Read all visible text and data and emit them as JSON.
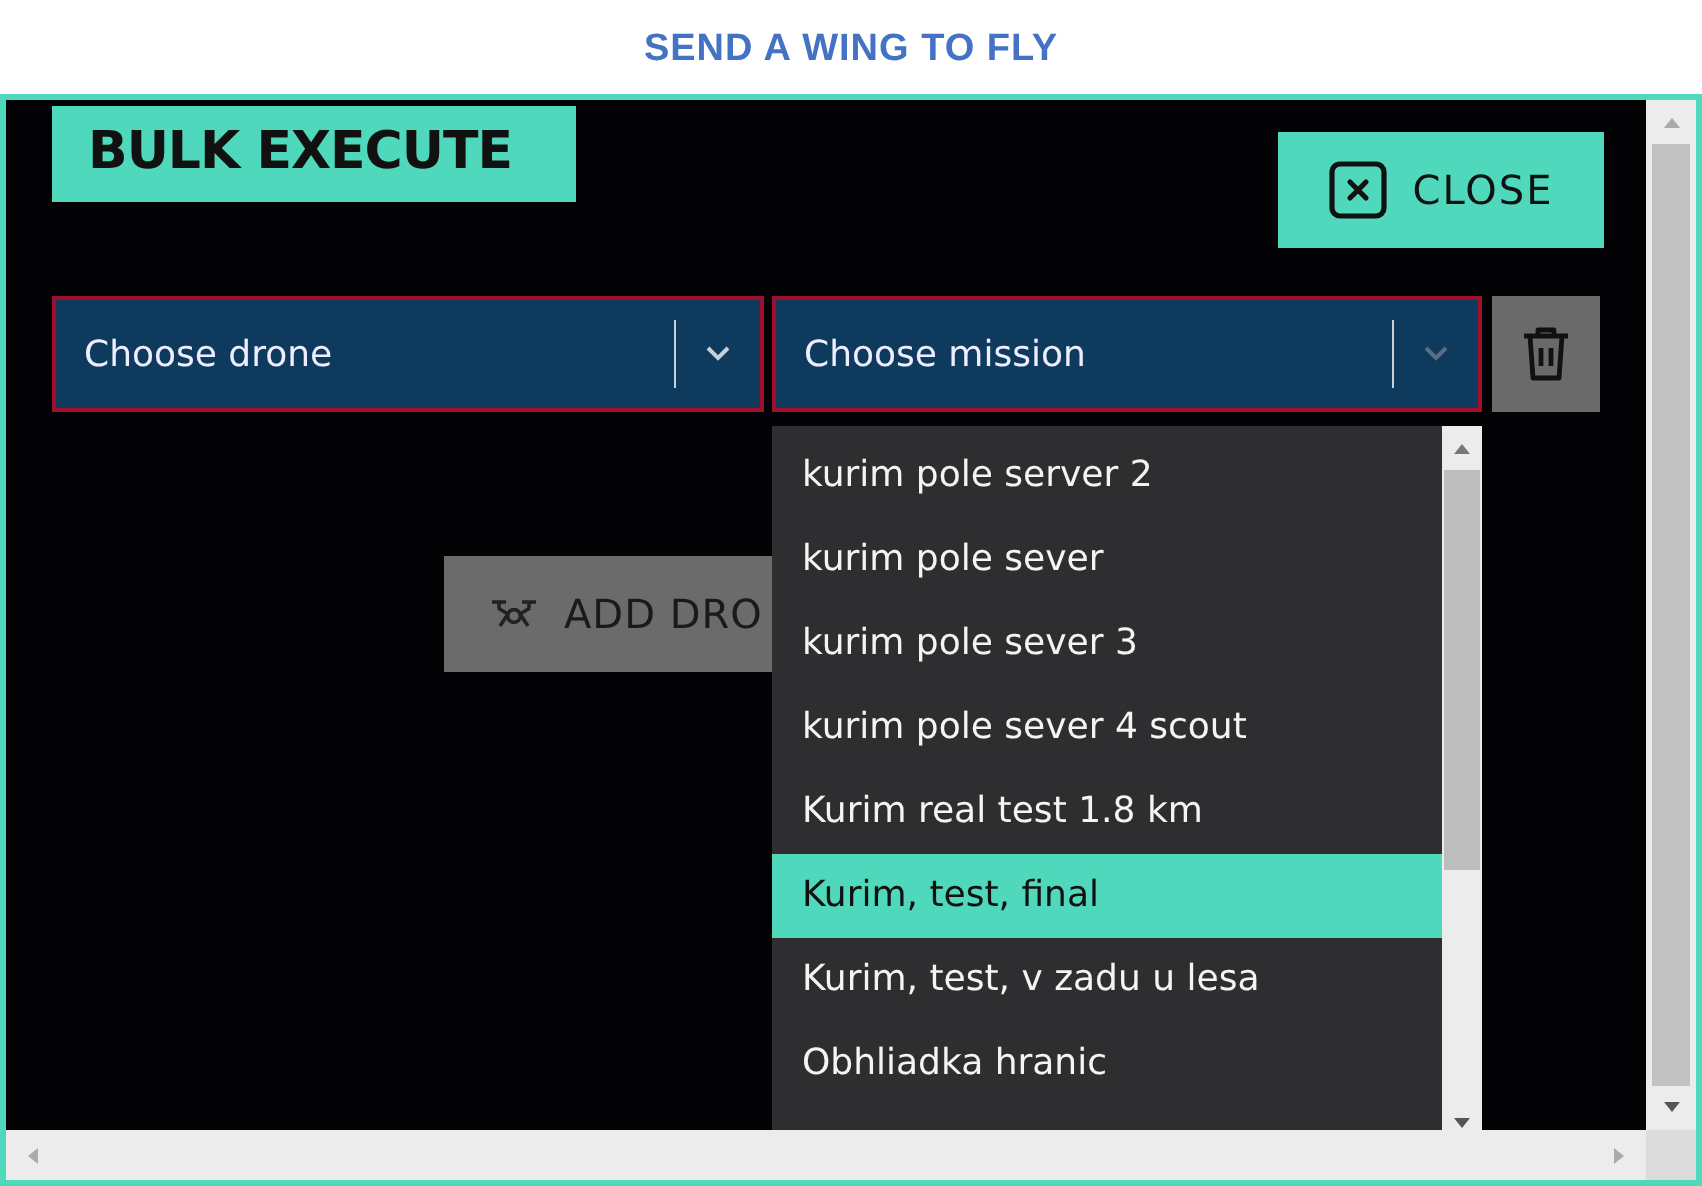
{
  "page_title": "SEND A WING TO FLY",
  "dialog": {
    "title": "BULK EXECUTE",
    "close_button": "CLOSE",
    "drone_select": {
      "placeholder": "Choose drone"
    },
    "mission_select": {
      "placeholder": "Choose mission",
      "expanded": true,
      "options": [
        {
          "label": "kurim pole server 2",
          "selected": false
        },
        {
          "label": "kurim pole sever",
          "selected": false
        },
        {
          "label": "kurim pole sever 3",
          "selected": false
        },
        {
          "label": "kurim pole sever 4 scout",
          "selected": false
        },
        {
          "label": "Kurim real test 1.8 km",
          "selected": false
        },
        {
          "label": "Kurim, test, final",
          "selected": true
        },
        {
          "label": "Kurim, test, v zadu u lesa",
          "selected": false
        },
        {
          "label": "Obhliadka hranic",
          "selected": false
        }
      ]
    },
    "add_button": "ADD DRO"
  }
}
